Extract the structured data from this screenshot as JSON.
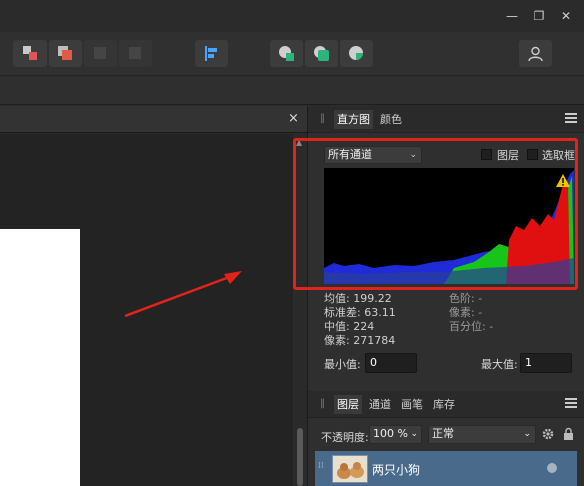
{
  "window": {
    "minimize_glyph": "—",
    "restore_glyph": "❐",
    "close_glyph": "✕"
  },
  "toolbar": {
    "buttons": [
      "arrange-icon",
      "combine-icon",
      "subtract-icon",
      "intersect-icon",
      "align-left-icon",
      "shape-circle-icon",
      "shape-square-icon",
      "shape-pie-icon",
      "user-icon"
    ]
  },
  "doc": {
    "close_glyph": "×"
  },
  "histogram_panel": {
    "tabs": [
      "直方图",
      "颜色"
    ],
    "channel_select": "所有通道",
    "layer_checkbox_label": "图层",
    "selection_checkbox_label": "选取框",
    "warning_glyph": "!",
    "stats_left": [
      "均值: 199.22",
      "标准差: 63.11",
      "中值: 224",
      "像素: 271784"
    ],
    "stats_right": [
      "色阶: -",
      "像素: -",
      "百分位: -"
    ],
    "min_label": "最小值:",
    "min_value": "0",
    "max_label": "最大值:",
    "max_value": "1"
  },
  "layers_panel": {
    "tabs": [
      "图层",
      "通道",
      "画笔",
      "库存"
    ],
    "opacity_label": "不透明度:",
    "opacity_value": "100 %",
    "blend_mode": "正常",
    "layer_name": "两只小狗"
  },
  "colors": {
    "highlight": "#e2231a",
    "layer_row": "#4a6a8c",
    "accent_green": "#2db37c"
  }
}
